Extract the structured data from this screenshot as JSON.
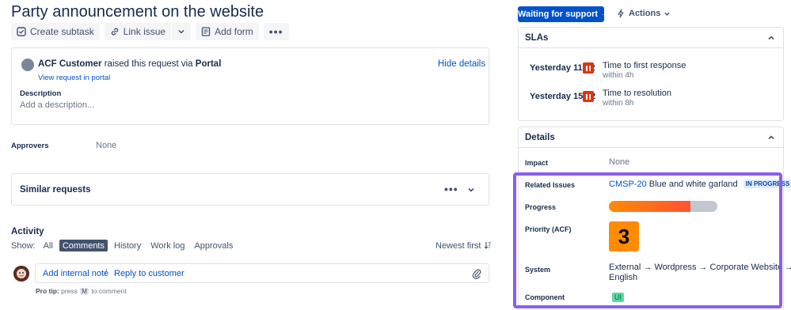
{
  "title": "Party announcement on the website",
  "toolbar": {
    "create_subtask": "Create subtask",
    "link_issue": "Link issue",
    "add_form": "Add form",
    "more": "•••"
  },
  "request": {
    "requester": "ACF Customer",
    "raised_text": "raised this request via",
    "channel": "Portal",
    "view_request": "View request in portal",
    "hide_details": "Hide details",
    "description_label": "Description",
    "description_placeholder": "Add a description..."
  },
  "approvers": {
    "label": "Approvers",
    "value": "None"
  },
  "similar": {
    "label": "Similar requests",
    "more": "•••"
  },
  "activity": {
    "label": "Activity",
    "show_label": "Show:",
    "filters": [
      "All",
      "Comments",
      "History",
      "Work log",
      "Approvals"
    ],
    "active_filter_index": 1,
    "sort": "Newest first",
    "add_internal_note": "Add internal note",
    "separator": "/",
    "reply_to_customer": "Reply to customer",
    "protip_prefix": "Pro tip:",
    "protip_press": "press",
    "protip_key": "M",
    "protip_suffix": "to comment"
  },
  "status_button": "Waiting for support",
  "actions_label": "Actions",
  "slas": {
    "title": "SLAs",
    "items": [
      {
        "time": "Yesterday 11:02",
        "name": "Time to first response",
        "target": "within 4h"
      },
      {
        "time": "Yesterday 15:02",
        "name": "Time to resolution",
        "target": "within 8h"
      }
    ]
  },
  "details": {
    "title": "Details",
    "impact": {
      "label": "Impact",
      "value": "None"
    },
    "related": {
      "label": "Related Issues",
      "key": "CMSP-20",
      "summary": "Blue and white garland",
      "status": "IN PROGRESS"
    },
    "progress": {
      "label": "Progress",
      "value": 0.75
    },
    "priority": {
      "label": "Priority (ACF)",
      "value": "3"
    },
    "system": {
      "label": "System",
      "line1": "External → Wordpress → Corporate Website →",
      "line2": "English"
    },
    "component": {
      "label": "Component",
      "value": "UI"
    }
  },
  "colors": {
    "accent": "#0052cc",
    "pause": "#de350b",
    "priority": "#ff8b00",
    "highlight": "#8b5cf6",
    "component_tag": "#57d9a3"
  }
}
